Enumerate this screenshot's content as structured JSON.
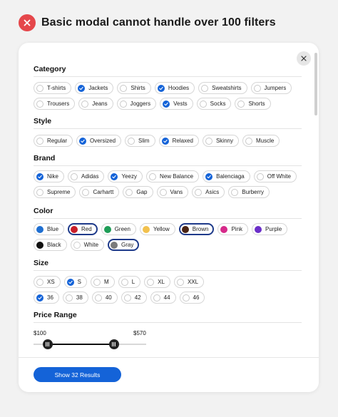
{
  "header": {
    "title": "Basic modal cannot handle over 100 filters",
    "badge_icon": "close-icon"
  },
  "modal": {
    "close_icon": "close-icon"
  },
  "sections": {
    "category": {
      "title": "Category",
      "rows": [
        [
          {
            "label": "T-shirts",
            "checked": false
          },
          {
            "label": "Jackets",
            "checked": true
          },
          {
            "label": "Shirts",
            "checked": false
          },
          {
            "label": "Hoodies",
            "checked": true
          },
          {
            "label": "Sweatshirts",
            "checked": false
          },
          {
            "label": "Jumpers",
            "checked": false
          }
        ],
        [
          {
            "label": "Trousers",
            "checked": false
          },
          {
            "label": "Jeans",
            "checked": false
          },
          {
            "label": "Joggers",
            "checked": false
          },
          {
            "label": "Vests",
            "checked": true
          },
          {
            "label": "Socks",
            "checked": false
          },
          {
            "label": "Shorts",
            "checked": false
          }
        ]
      ]
    },
    "style": {
      "title": "Style",
      "rows": [
        [
          {
            "label": "Regular",
            "checked": false
          },
          {
            "label": "Oversized",
            "checked": true
          },
          {
            "label": "Slim",
            "checked": false
          },
          {
            "label": "Relaxed",
            "checked": true
          },
          {
            "label": "Skinny",
            "checked": false
          },
          {
            "label": "Muscle",
            "checked": false
          }
        ]
      ]
    },
    "brand": {
      "title": "Brand",
      "rows": [
        [
          {
            "label": "Nike",
            "checked": true
          },
          {
            "label": "Adidas",
            "checked": false
          },
          {
            "label": "Yeezy",
            "checked": true
          },
          {
            "label": "New Balance",
            "checked": false
          },
          {
            "label": "Balenciaga",
            "checked": true
          },
          {
            "label": "Off White",
            "checked": false
          }
        ],
        [
          {
            "label": "Supreme",
            "checked": false
          },
          {
            "label": "Carhartt",
            "checked": false
          },
          {
            "label": "Gap",
            "checked": false
          },
          {
            "label": "Vans",
            "checked": false
          },
          {
            "label": "Asics",
            "checked": false
          },
          {
            "label": "Burberry",
            "checked": false
          }
        ]
      ]
    },
    "color": {
      "title": "Color",
      "rows": [
        [
          {
            "label": "Blue",
            "color": "#1f6fd1",
            "selected": false
          },
          {
            "label": "Red",
            "color": "#c81e2a",
            "selected": true
          },
          {
            "label": "Green",
            "color": "#1f9d57",
            "selected": false
          },
          {
            "label": "Yellow",
            "color": "#f2c14e",
            "selected": false
          },
          {
            "label": "Brown",
            "color": "#4a2414",
            "selected": true
          },
          {
            "label": "Pink",
            "color": "#d62a8a",
            "selected": false
          },
          {
            "label": "Purple",
            "color": "#6b2fc9",
            "selected": false
          }
        ],
        [
          {
            "label": "Black",
            "color": "#111111",
            "selected": false
          },
          {
            "label": "White",
            "color": "#ffffff",
            "selected": false
          },
          {
            "label": "Gray",
            "color": "#7b7b7b",
            "selected": true
          }
        ]
      ]
    },
    "size": {
      "title": "Size",
      "rows": [
        [
          {
            "label": "XS",
            "checked": false
          },
          {
            "label": "S",
            "checked": true
          },
          {
            "label": "M",
            "checked": false
          },
          {
            "label": "L",
            "checked": false
          },
          {
            "label": "XL",
            "checked": false
          },
          {
            "label": "XXL",
            "checked": false
          }
        ],
        [
          {
            "label": "36",
            "checked": true
          },
          {
            "label": "38",
            "checked": false
          },
          {
            "label": "40",
            "checked": false
          },
          {
            "label": "42",
            "checked": false
          },
          {
            "label": "44",
            "checked": false
          },
          {
            "label": "46",
            "checked": false
          }
        ]
      ]
    },
    "price": {
      "title": "Price Range",
      "min_label": "$100",
      "max_label": "$570",
      "range_min": 0,
      "range_max": 800,
      "value_low": 100,
      "value_high": 570
    }
  },
  "footer": {
    "show_button_label": "Show 32 Results"
  },
  "colors": {
    "accent": "#1463d8",
    "danger": "#e5474b",
    "selected_ring": "#1e3a8a"
  }
}
